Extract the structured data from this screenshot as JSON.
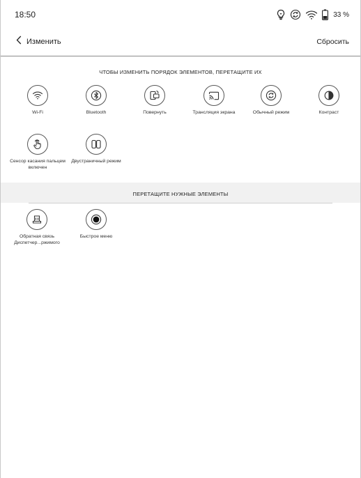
{
  "status_bar": {
    "time": "18:50",
    "battery_percent": "33 %",
    "icons": [
      "lightbulb-icon",
      "sync-icon",
      "wifi-icon",
      "battery-icon"
    ]
  },
  "header": {
    "back_label": "Изменить",
    "reset_label": "Сбросить"
  },
  "section_active": {
    "title": "ЧТОБЫ ИЗМЕНИТЬ ПОРЯДОК ЭЛЕМЕНТОВ, ПЕРЕТАЩИТЕ ИХ",
    "items": [
      {
        "label": "Wi-Fi",
        "icon": "wifi-icon"
      },
      {
        "label": "Bluetooth",
        "icon": "bluetooth-icon"
      },
      {
        "label": "Повернуть",
        "icon": "rotate-icon"
      },
      {
        "label": "Трансляция экрана",
        "icon": "cast-icon"
      },
      {
        "label": "Обычный режим",
        "icon": "refresh-mode-icon"
      },
      {
        "label": "Контраст",
        "icon": "contrast-icon"
      },
      {
        "label": "Сенсор касания пальцем включен",
        "icon": "touch-hand-icon"
      },
      {
        "label": "Двустраничный режим",
        "icon": "dual-page-icon"
      }
    ]
  },
  "section_available": {
    "title": "ПЕРЕТАЩИТЕ НУЖНЫЕ ЭЛЕМЕНТЫ",
    "items": [
      {
        "label": "Обратная связь Диспетчер...ржимого",
        "icon": "feedback-icon"
      },
      {
        "label": "Быстрое меню",
        "icon": "quick-menu-icon"
      }
    ]
  }
}
